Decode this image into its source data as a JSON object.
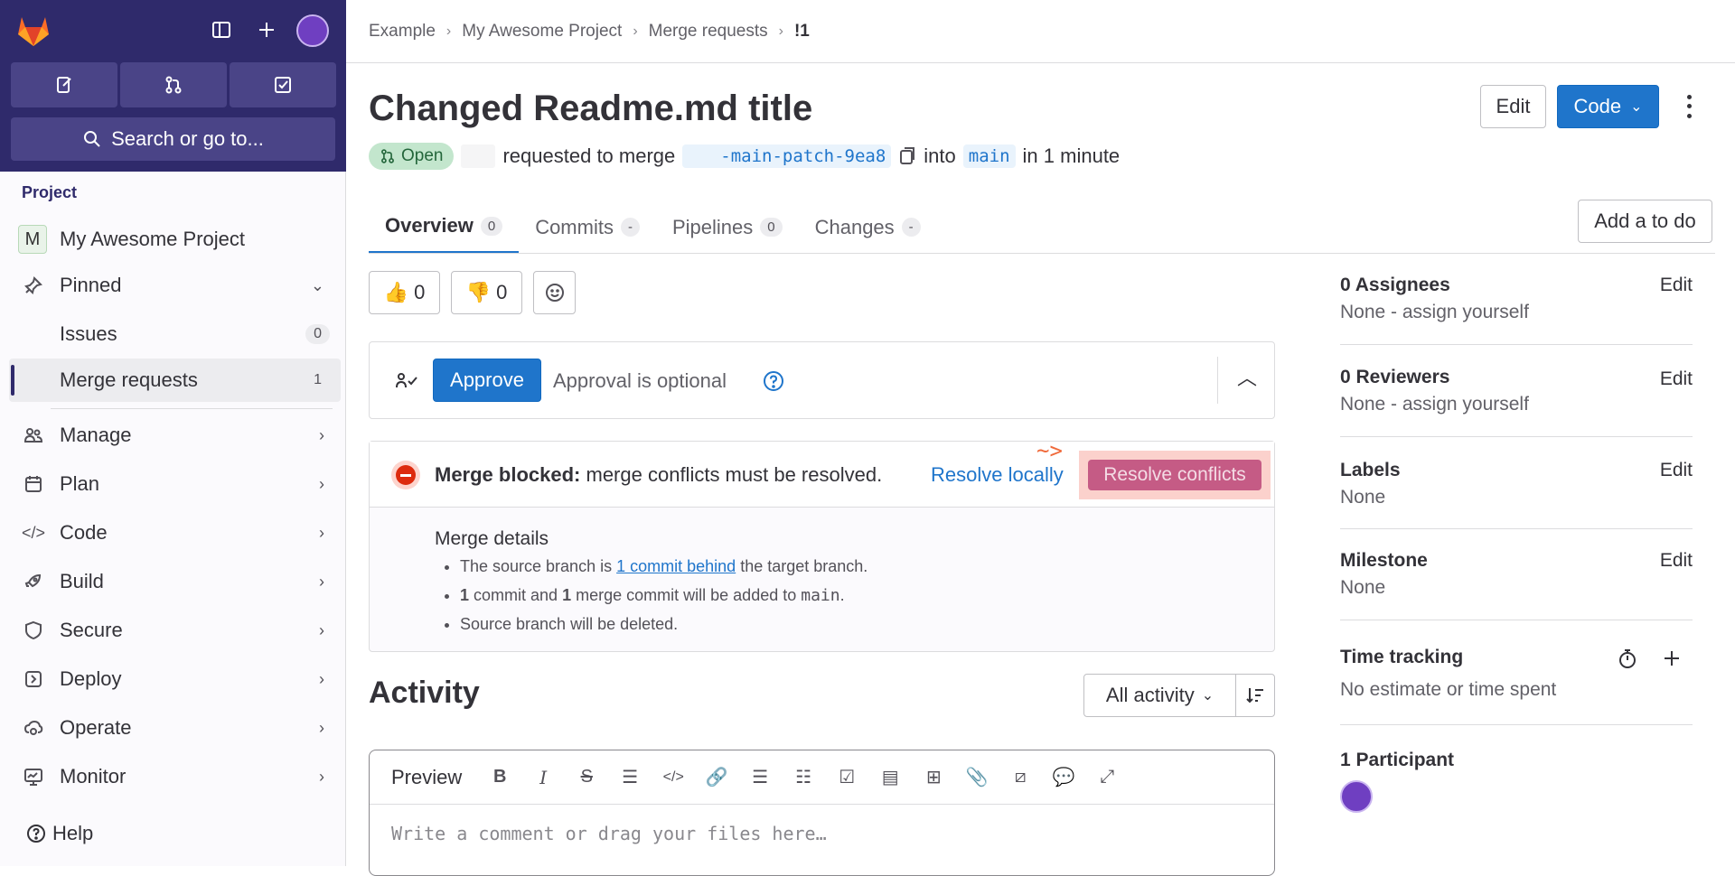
{
  "sidebar": {
    "search_label": "Search or go to...",
    "section_title": "Project",
    "project_initial": "M",
    "project_name": "My Awesome Project",
    "pinned_label": "Pinned",
    "pinned_items": [
      {
        "label": "Issues",
        "count": "0"
      },
      {
        "label": "Merge requests",
        "count": "1"
      }
    ],
    "nav_items": [
      {
        "label": "Manage"
      },
      {
        "label": "Plan"
      },
      {
        "label": "Code"
      },
      {
        "label": "Build"
      },
      {
        "label": "Secure"
      },
      {
        "label": "Deploy"
      },
      {
        "label": "Operate"
      },
      {
        "label": "Monitor"
      }
    ],
    "help_label": "Help"
  },
  "breadcrumb": [
    "Example",
    "My Awesome Project",
    "Merge requests",
    "!1"
  ],
  "mr": {
    "title": "Changed Readme.md title",
    "edit_label": "Edit",
    "code_label": "Code",
    "status": "Open",
    "requested_text": "requested to merge",
    "source_branch": "-main-patch-9ea8",
    "into_text": "into",
    "target_branch": "main",
    "time_text": "in 1 minute"
  },
  "tabs": [
    {
      "label": "Overview",
      "count": "0"
    },
    {
      "label": "Commits",
      "count": "-"
    },
    {
      "label": "Pipelines",
      "count": "0"
    },
    {
      "label": "Changes",
      "count": "-"
    }
  ],
  "add_todo_label": "Add a to do",
  "reactions": {
    "thumbs_up": "0",
    "thumbs_down": "0"
  },
  "approval": {
    "approve_label": "Approve",
    "optional_text": "Approval is optional"
  },
  "merge_block": {
    "bold_text": "Merge blocked:",
    "text": "merge conflicts must be resolved.",
    "resolve_locally": "Resolve locally",
    "resolve_conflicts": "Resolve conflicts",
    "annotation": "~>",
    "details_title": "Merge details",
    "d1_pre": "The source branch is",
    "d1_link": "1 commit behind",
    "d1_post": "the target branch.",
    "d2_n1": "1",
    "d2_mid": "commit and",
    "d2_n2": "1",
    "d2_post": "merge commit will be added to",
    "d2_branch": "main",
    "d2_end": ".",
    "d3": "Source branch will be deleted."
  },
  "activity": {
    "title": "Activity",
    "filter_label": "All activity",
    "preview_label": "Preview",
    "placeholder": "Write a comment or drag your files here…"
  },
  "right": {
    "assignees_title": "0 Assignees",
    "assignees_val": "None - assign yourself",
    "reviewers_title": "0 Reviewers",
    "reviewers_val": "None -  assign yourself",
    "labels_title": "Labels",
    "labels_val": "None",
    "milestone_title": "Milestone",
    "milestone_val": "None",
    "time_title": "Time tracking",
    "time_val": "No estimate or time spent",
    "participants_title": "1 Participant",
    "edit_label": "Edit"
  },
  "colors": {
    "brand": "#2f2a6b",
    "primary": "#1f75cb",
    "danger": "#dd2b0e",
    "open_badge": "#c3e6cd"
  }
}
